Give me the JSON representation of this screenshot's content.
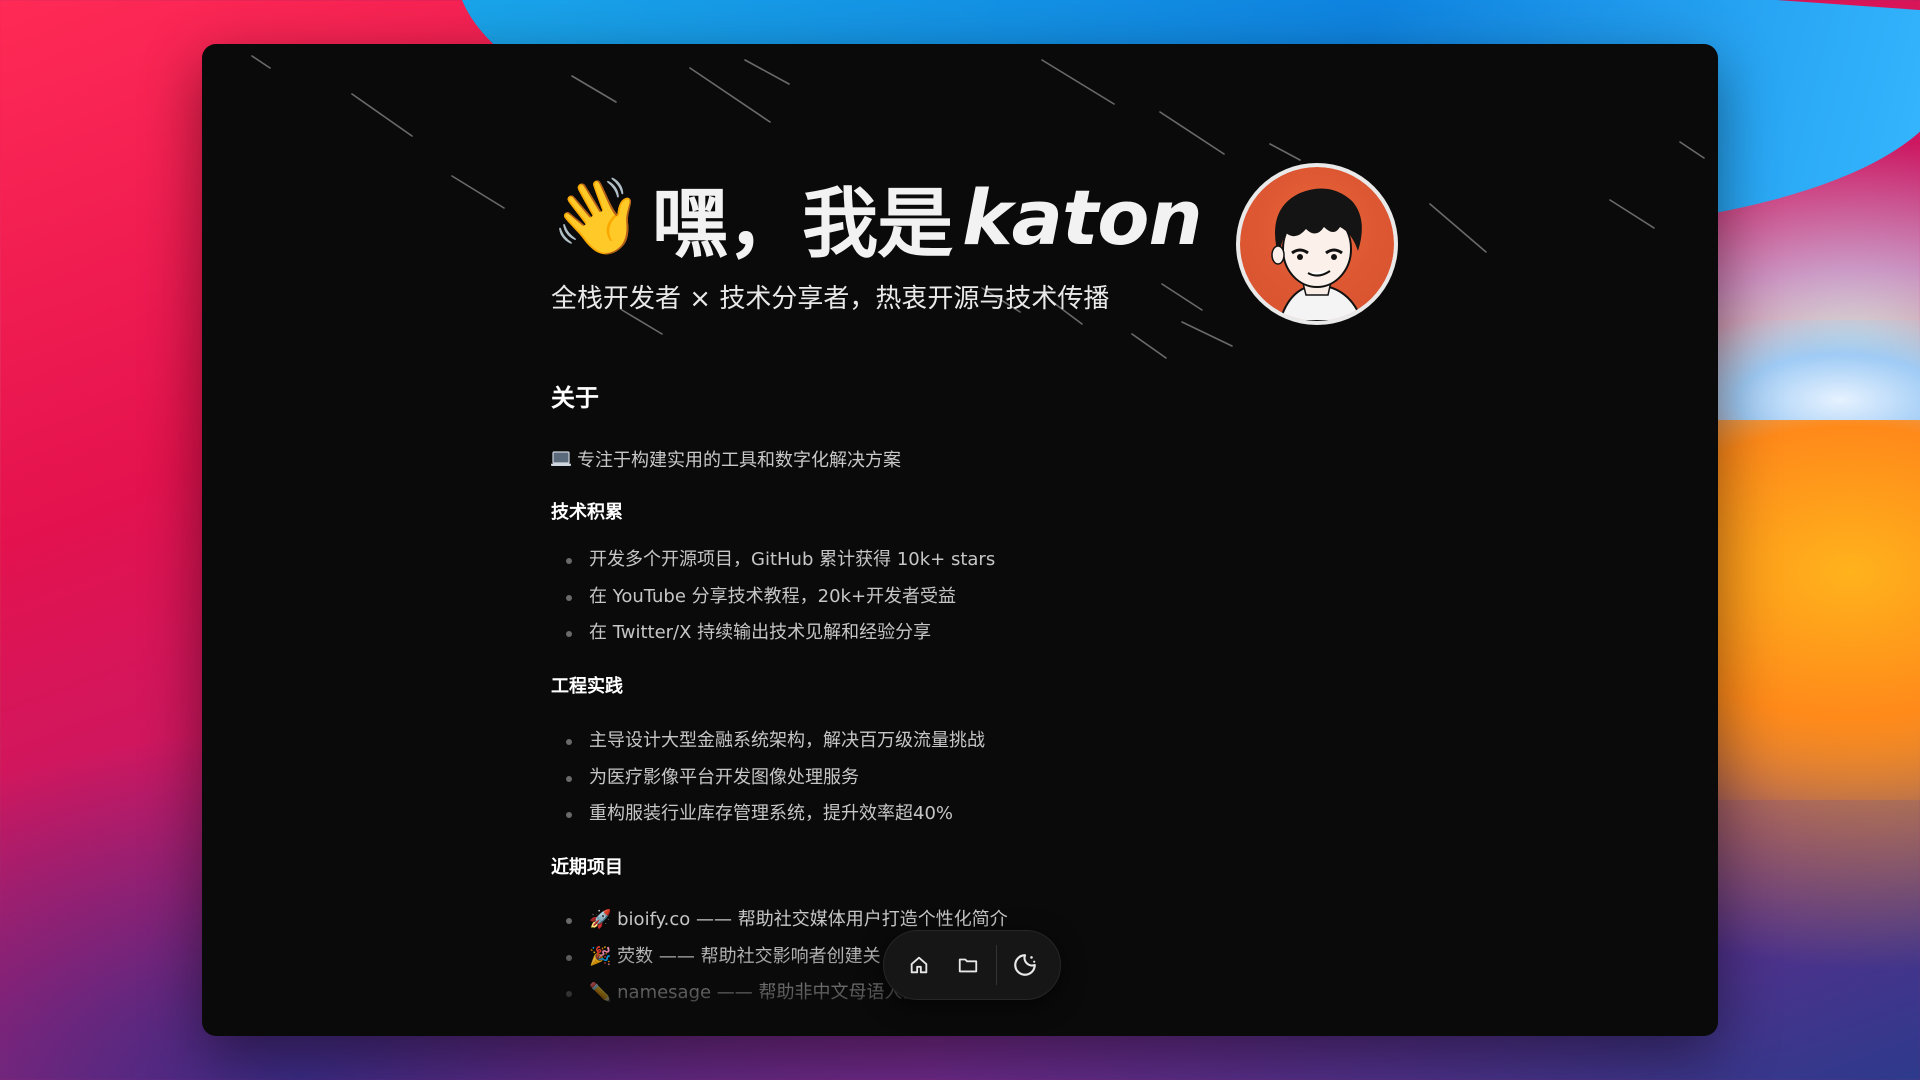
{
  "hero": {
    "greeting": "嘿，我是",
    "name": "katon",
    "wave_emoji": "👋",
    "subtitle": "全栈开发者 × 技术分享者，热衷开源与技术传播"
  },
  "about": {
    "title": "关于",
    "intro": "专注于构建实用的工具和数字化解决方案",
    "groups": [
      {
        "heading": "技术积累",
        "items": [
          "开发多个开源项目，GitHub 累计获得 10k+ stars",
          "在 YouTube 分享技术教程，20k+开发者受益",
          "在 Twitter/X 持续输出技术见解和经验分享"
        ]
      },
      {
        "heading": "工程实践",
        "items": [
          "主导设计大型金融系统架构，解决百万级流量挑战",
          "为医疗影像平台开发图像处理服务",
          "重构服装行业库存管理系统，提升效率超40%"
        ]
      },
      {
        "heading": "近期项目",
        "items": [
          "🚀 bioify.co —— 帮助社交媒体用户打造个性化简介",
          "🎉 荧数 —— 帮助社交影响者创建关",
          "✏️ namesage —— 帮助非中文母语人士起中文名"
        ]
      }
    ]
  },
  "dock": {
    "items": [
      "home-icon",
      "folder-icon",
      "theme-toggle-icon"
    ]
  },
  "colors": {
    "window_bg": "#0a0a0a",
    "heading": "#ffffff",
    "body_text": "#c6c6c6",
    "avatar_bg": "#e05a35"
  }
}
